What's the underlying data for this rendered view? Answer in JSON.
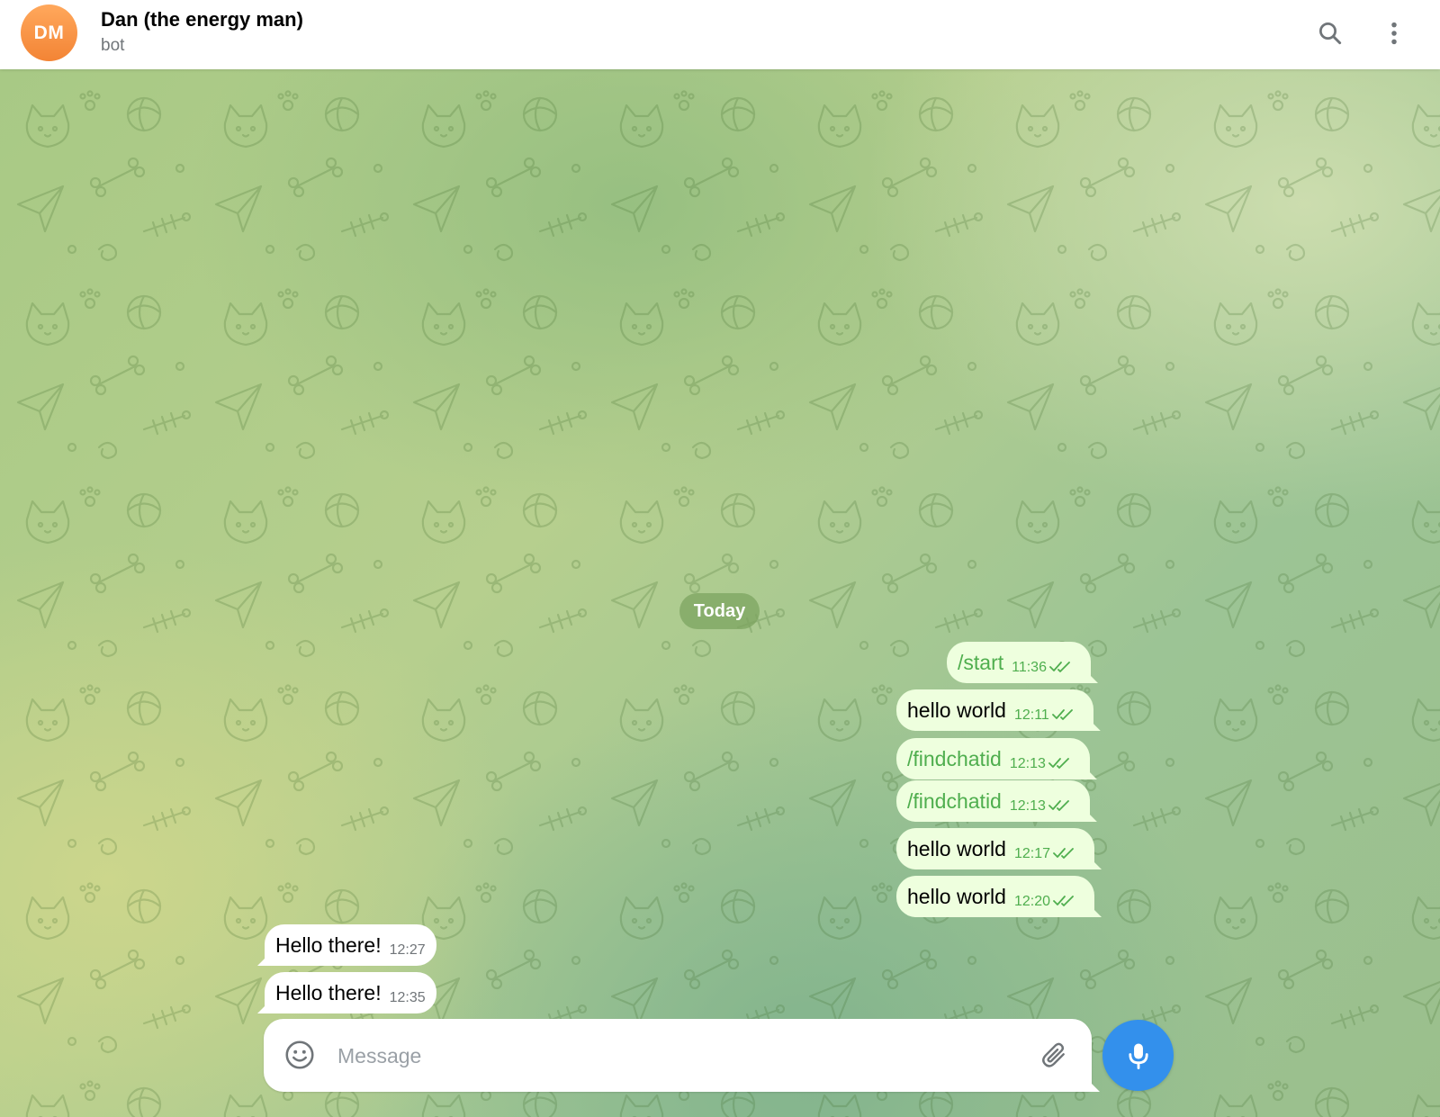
{
  "header": {
    "avatar_initials": "DM",
    "title": "Dan (the energy man)",
    "subtitle": "bot",
    "search_icon": "search-icon",
    "more_icon": "more-vertical-icon"
  },
  "chat": {
    "date_label": "Today",
    "messages": [
      {
        "direction": "out",
        "text": "/start",
        "time": "11:36",
        "status": "read",
        "is_command": true
      },
      {
        "direction": "out",
        "text": "hello world",
        "time": "12:11",
        "status": "read",
        "is_command": false
      },
      {
        "direction": "out",
        "text": "/findchatid",
        "time": "12:13",
        "status": "read",
        "is_command": true
      },
      {
        "direction": "out",
        "text": "/findchatid",
        "time": "12:13",
        "status": "read",
        "is_command": true
      },
      {
        "direction": "out",
        "text": "hello world",
        "time": "12:17",
        "status": "read",
        "is_command": false
      },
      {
        "direction": "out",
        "text": "hello world",
        "time": "12:20",
        "status": "read",
        "is_command": false
      },
      {
        "direction": "in",
        "text": "Hello there!",
        "time": "12:27"
      },
      {
        "direction": "in",
        "text": "Hello there!",
        "time": "12:35"
      }
    ]
  },
  "composer": {
    "placeholder": "Message",
    "value": "",
    "emoji_icon": "smile-icon",
    "attach_icon": "paperclip-icon",
    "mic_icon": "microphone-icon"
  },
  "colors": {
    "accent": "#3390ec",
    "avatar": "#f38435",
    "outgoing_bubble": "#eeffde",
    "incoming_bubble": "#ffffff",
    "command_text": "#4fae4e",
    "date_badge": "#7ca460"
  }
}
